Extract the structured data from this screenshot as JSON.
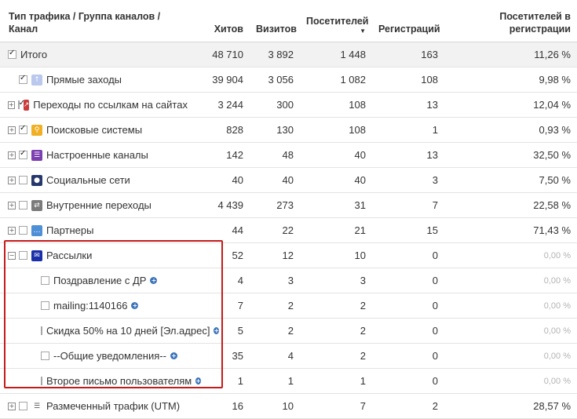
{
  "headers": {
    "name": "Тип трафика / Группа каналов / Канал",
    "hits": "Хитов",
    "visits": "Визитов",
    "visitors": "Посетителей",
    "registrations": "Регистраций",
    "reg_visitors": "Посетителей в регистрации",
    "sort_indicator": "▼"
  },
  "colors": {
    "highlight_border": "#c41b1b",
    "accent_blue": "#3b73b9"
  },
  "rows": [
    {
      "name": "Итого",
      "hits": "48 710",
      "visits": "3 892",
      "visitors": "1 448",
      "registrations": "163",
      "reg_visitors": "11,26 %",
      "icon": "none",
      "checked": true,
      "expander": ""
    },
    {
      "name": "Прямые заходы",
      "hits": "39 904",
      "visits": "3 056",
      "visitors": "1 082",
      "registrations": "108",
      "reg_visitors": "9,98 %",
      "icon": "up-arrow-icon",
      "checked": true,
      "expander": ""
    },
    {
      "name": "Переходы по ссылкам на сайтах",
      "hits": "3 244",
      "visits": "300",
      "visitors": "108",
      "registrations": "13",
      "reg_visitors": "12,04 %",
      "icon": "external-link-icon",
      "checked": true,
      "expander": "+"
    },
    {
      "name": "Поисковые системы",
      "hits": "828",
      "visits": "130",
      "visitors": "108",
      "registrations": "1",
      "reg_visitors": "0,93 %",
      "icon": "search-icon",
      "checked": true,
      "expander": "+"
    },
    {
      "name": "Настроенные каналы",
      "hits": "142",
      "visits": "48",
      "visitors": "40",
      "registrations": "13",
      "reg_visitors": "32,50 %",
      "icon": "list-icon",
      "checked": true,
      "expander": "+"
    },
    {
      "name": "Социальные сети",
      "hits": "40",
      "visits": "40",
      "visitors": "40",
      "registrations": "3",
      "reg_visitors": "7,50 %",
      "icon": "person-icon",
      "checked": false,
      "expander": "+"
    },
    {
      "name": "Внутренние переходы",
      "hits": "4 439",
      "visits": "273",
      "visitors": "31",
      "registrations": "7",
      "reg_visitors": "22,58 %",
      "icon": "swap-icon",
      "checked": false,
      "expander": "+"
    },
    {
      "name": "Партнеры",
      "hits": "44",
      "visits": "22",
      "visitors": "21",
      "registrations": "15",
      "reg_visitors": "71,43 %",
      "icon": "chat-icon",
      "checked": false,
      "expander": "+"
    },
    {
      "name": "Рассылки",
      "hits": "52",
      "visits": "12",
      "visitors": "10",
      "registrations": "0",
      "reg_visitors": "0,00 %",
      "icon": "mail-icon",
      "checked": false,
      "expander": "−"
    },
    {
      "name": "Поздравление с ДР",
      "hits": "4",
      "visits": "3",
      "visitors": "3",
      "registrations": "0",
      "reg_visitors": "0,00 %",
      "icon": "none",
      "checked": false,
      "expander": "",
      "child": true
    },
    {
      "name": "mailing:1140166",
      "hits": "7",
      "visits": "2",
      "visitors": "2",
      "registrations": "0",
      "reg_visitors": "0,00 %",
      "icon": "none",
      "checked": false,
      "expander": "",
      "child": true
    },
    {
      "name": "Скидка 50% на 10 дней [Эл.адрес]",
      "hits": "5",
      "visits": "2",
      "visitors": "2",
      "registrations": "0",
      "reg_visitors": "0,00 %",
      "icon": "none",
      "checked": false,
      "expander": "",
      "child": true
    },
    {
      "name": "--Общие уведомления--",
      "hits": "35",
      "visits": "4",
      "visitors": "2",
      "registrations": "0",
      "reg_visitors": "0,00 %",
      "icon": "none",
      "checked": false,
      "expander": "",
      "child": true
    },
    {
      "name": "Второе письмо пользователям",
      "hits": "1",
      "visits": "1",
      "visitors": "1",
      "registrations": "0",
      "reg_visitors": "0,00 %",
      "icon": "none",
      "checked": false,
      "expander": "",
      "child": true
    },
    {
      "name": "Размеченный трафик (UTM)",
      "hits": "16",
      "visits": "10",
      "visitors": "7",
      "registrations": "2",
      "reg_visitors": "28,57 %",
      "icon": "lines-icon",
      "checked": false,
      "expander": "+"
    }
  ]
}
